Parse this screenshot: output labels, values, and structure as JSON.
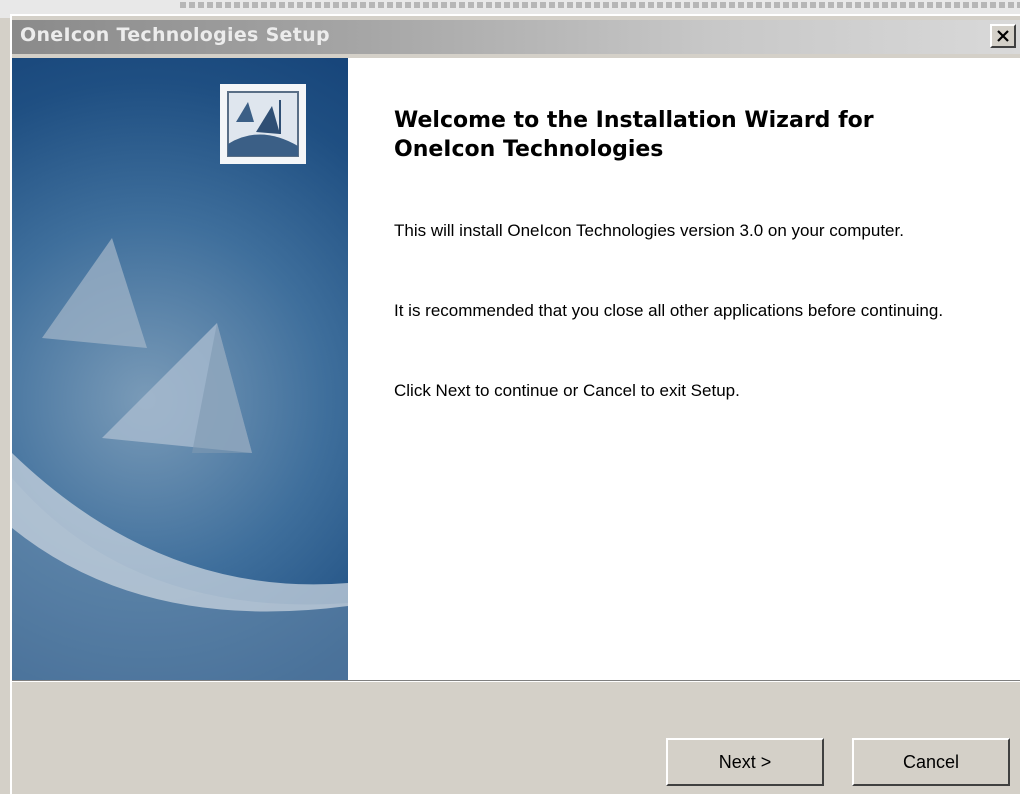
{
  "window": {
    "title": "OneIcon Technologies Setup",
    "close_label": "×"
  },
  "sidebar": {
    "logo_icon": "setup-logo-icon",
    "graphic": "sails-graphic"
  },
  "wizard": {
    "heading": "Welcome to the Installation Wizard for OneIcon Technologies",
    "paragraphs": [
      "This will install OneIcon Technologies version 3.0 on your computer.",
      "It is recommended that you close all other applications before  continuing.",
      "Click Next to continue or Cancel to exit Setup."
    ]
  },
  "buttons": {
    "next": "Next >",
    "cancel": "Cancel"
  }
}
